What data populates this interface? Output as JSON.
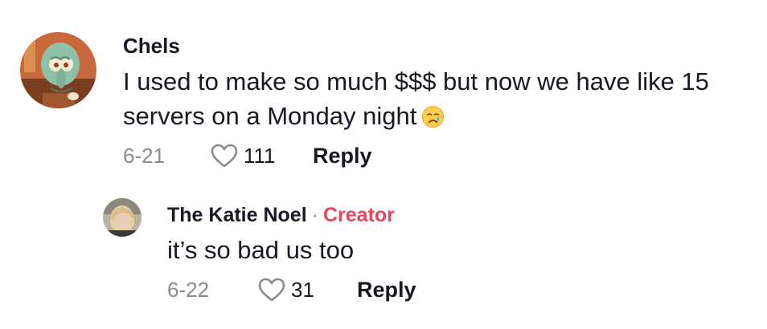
{
  "comment": {
    "username": "Chels",
    "text_line1": "I used to make so much $$$ but now we have like 15",
    "text_line2": "servers on a Monday night",
    "emoji_icon": "crying-face-icon",
    "date": "6-21",
    "likes": "111",
    "reply_label": "Reply"
  },
  "reply": {
    "username": "The Katie Noel",
    "separator": "·",
    "badge": "Creator",
    "text": "it’s so bad us too",
    "date": "6-22",
    "likes": "31",
    "reply_label": "Reply"
  },
  "colors": {
    "text": "#161823",
    "muted": "#8a8b91",
    "creator_badge": "#e8445a"
  }
}
